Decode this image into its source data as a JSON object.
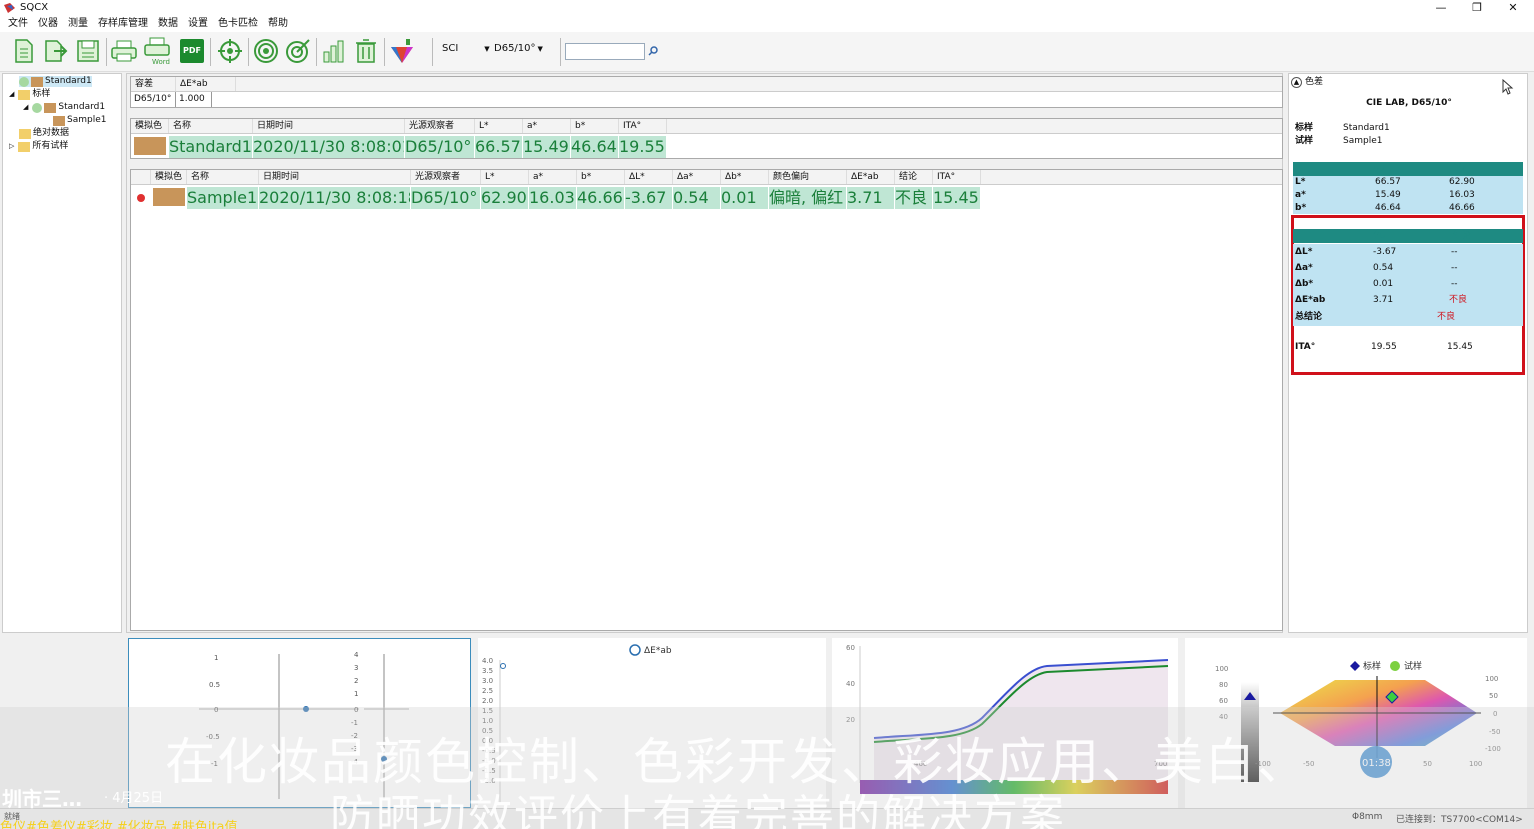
{
  "window": {
    "title": "SQCX",
    "min": "—",
    "restore": "❐",
    "close": "✕"
  },
  "menu": [
    "文件",
    "仪器",
    "测量",
    "存样库管理",
    "数据",
    "设置",
    "色卡匹检",
    "帮助"
  ],
  "toolbar": {
    "pdf_label": "PDF",
    "word_label": "Word",
    "sci": "SCI",
    "illuminant": "D65/10°",
    "search_placeholder": ""
  },
  "tree": {
    "standard_root": "Standard1",
    "group_label": "标样",
    "standard_child": "Standard1",
    "sample": "Sample1",
    "abs_data": "绝对数据",
    "all_samples": "所有试样"
  },
  "tolerance": {
    "headers": [
      "容差",
      "ΔE*ab"
    ],
    "row": [
      "D65/10°",
      "1.000"
    ]
  },
  "standard_table": {
    "headers": [
      "模拟色",
      "名称",
      "日期时间",
      "光源观察者",
      "L*",
      "a*",
      "b*",
      "ITA°"
    ],
    "row": {
      "name": "Standard1",
      "datetime": "2020/11/30 8:08:01",
      "illum": "D65/10°",
      "L": "66.57",
      "a": "15.49",
      "b": "46.64",
      "ita": "19.55"
    }
  },
  "sample_table": {
    "headers": [
      "",
      "模拟色",
      "名称",
      "日期时间",
      "光源观察者",
      "L*",
      "a*",
      "b*",
      "ΔL*",
      "Δa*",
      "Δb*",
      "颜色偏向",
      "ΔE*ab",
      "结论",
      "ITA°"
    ],
    "row": {
      "name": "Sample1",
      "datetime": "2020/11/30 8:08:18",
      "illum": "D65/10°",
      "L": "62.90",
      "a": "16.03",
      "b": "46.66",
      "dL": "-3.67",
      "da": "0.54",
      "db": "0.01",
      "tendency": "偏暗, 偏红",
      "dE": "3.71",
      "result": "不良",
      "ita": "15.45"
    }
  },
  "right": {
    "section": "色差",
    "title": "CIE LAB, D65/10°",
    "std_label": "标样",
    "std_value": "Standard1",
    "smp_label": "试样",
    "smp_value": "Sample1",
    "lab_header": [
      "",
      "标样",
      "试样"
    ],
    "lab_rows": [
      [
        "L*",
        "66.57",
        "62.90"
      ],
      [
        "a*",
        "15.49",
        "16.03"
      ],
      [
        "b*",
        "46.64",
        "46.66"
      ]
    ],
    "diff_header": [
      "",
      "色差",
      "结论"
    ],
    "diff_rows": [
      [
        "ΔL*",
        "-3.67",
        "--"
      ],
      [
        "Δa*",
        "0.54",
        "--"
      ],
      [
        "Δb*",
        "0.01",
        "--"
      ],
      [
        "ΔE*ab",
        "3.71",
        "不良"
      ]
    ],
    "total_label": "总结论",
    "total_value": "不良",
    "ita": [
      "ITA°",
      "19.55",
      "15.45"
    ]
  },
  "charts": {
    "de_legend": "ΔE*ab",
    "legend_std": "标样",
    "legend_smp": "试样",
    "timer": "01:38",
    "c1_ticks_left": [
      "1",
      "0.5",
      "0",
      "-0.5",
      "-1"
    ],
    "c1_ticks_right": [
      "4",
      "3",
      "2",
      "1",
      "0",
      "-1",
      "-2",
      "-3",
      "-4"
    ],
    "c2_ticks": [
      "4.0",
      "3.5",
      "3.0",
      "2.5",
      "2.0",
      "1.5",
      "1.0",
      "0.5",
      "0.0",
      "-0.5",
      "-1.0",
      "-1.5",
      "-2.0"
    ],
    "c3_ticks": [
      "60",
      "40",
      "20"
    ],
    "c3_x": [
      "460",
      "700"
    ],
    "c4_left": [
      "100",
      "80",
      "60",
      "40"
    ],
    "c4_right": [
      "100",
      "50",
      "0",
      "-50",
      "-100"
    ],
    "c4_x": [
      "-100",
      "-50",
      "0",
      "50",
      "100"
    ]
  },
  "status": {
    "left": "就绪",
    "aperture": "Φ8mm",
    "conn": "已连接到：TS7700<COM14>"
  },
  "overlay": {
    "caption1": "在化妆品颜色控制、色彩开发、彩妆应用、美白、",
    "caption2": "防晒功效评价上有着完善的解决方案",
    "author": "圳市三…",
    "date": "· 4月25日",
    "tags": "色仪#色差仪#彩妆 #化妆品 #肤色ita值"
  },
  "colors": {
    "swatch": "#c8955a",
    "grid_green": "#bfe6d4",
    "teal": "#1e8a82",
    "red_box": "#d0101a"
  }
}
